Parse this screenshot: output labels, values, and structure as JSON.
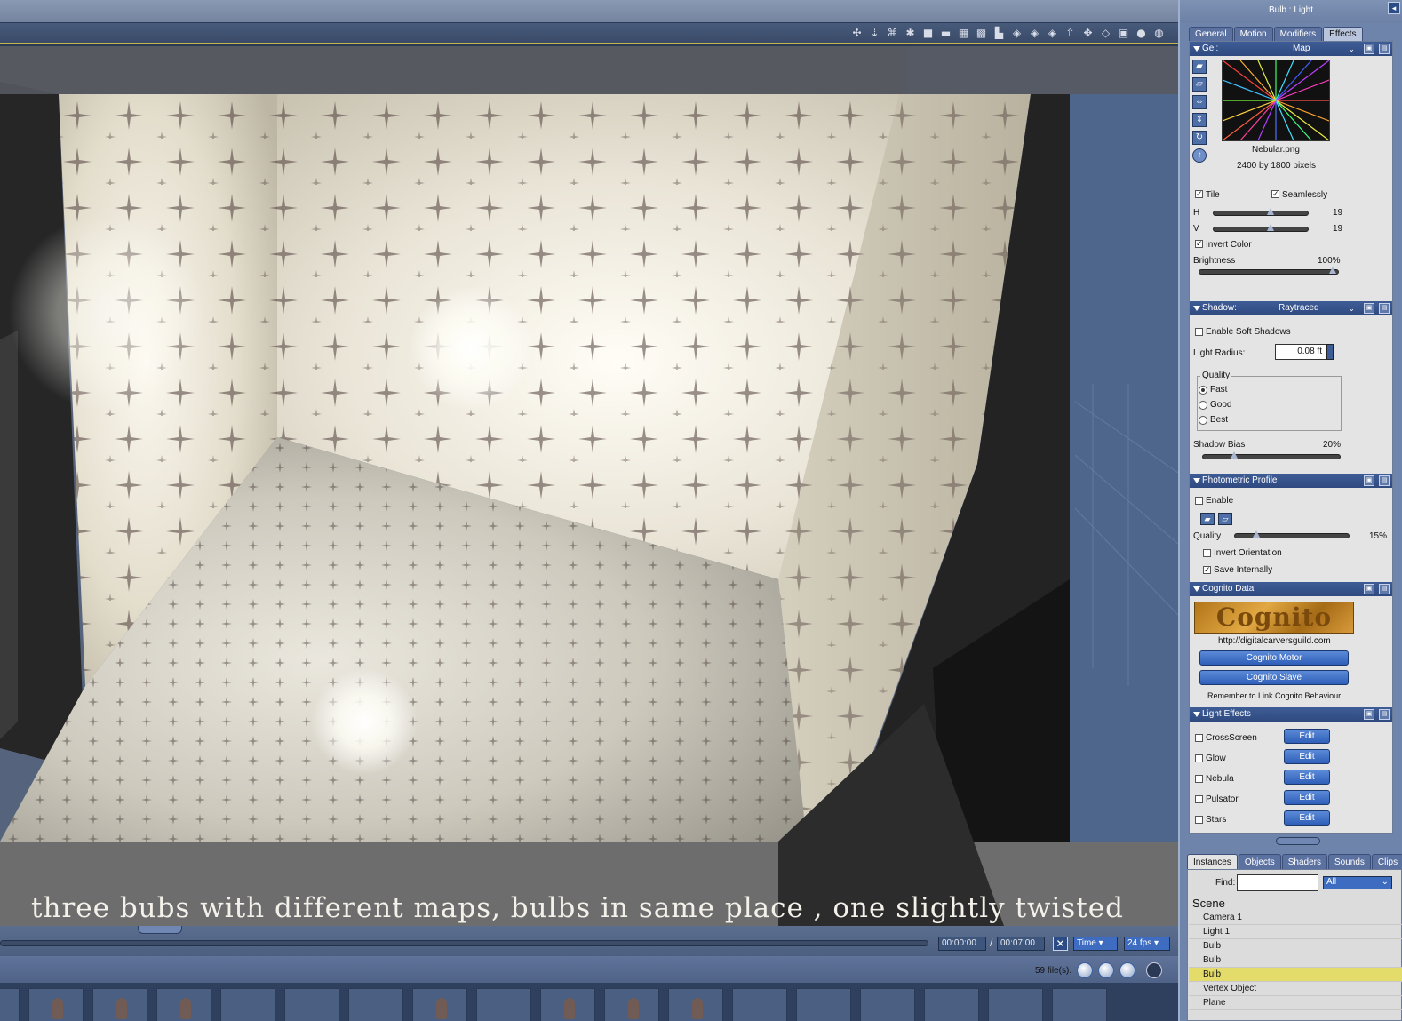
{
  "viewport": {
    "caption": "three bubs with different maps, bulbs in same place , one slightly twisted",
    "toolbar_icons": [
      "pivot-icon",
      "move-icon",
      "camera-icon",
      "target-icon",
      "single-view-icon",
      "dual-view-icon",
      "quad-view-icon",
      "grid-view-icon",
      "multi-view-icon",
      "shield-1-icon",
      "shield-2-icon",
      "shield-3-icon",
      "up-arrow-icon",
      "transform-icon",
      "box-icon",
      "cube-icon",
      "sphere-shaded-icon",
      "sphere-solid-icon"
    ]
  },
  "timeline": {
    "current_time": "00:00:00",
    "separator": "/",
    "end_time": "00:07:00",
    "mode": "Time",
    "fps": "24 fps"
  },
  "library": {
    "file_count": "59 file(s)."
  },
  "panel": {
    "title": "Bulb : Light",
    "close_glyph": "◂",
    "tabs": [
      "General",
      "Motion",
      "Modifiers",
      "Effects"
    ],
    "gel": {
      "header": "Gel:",
      "mode": "Map",
      "file_name": "Nebular.png",
      "file_size": "2400 by 1800 pixels",
      "tile_label": "Tile",
      "tile_checked": true,
      "seamless_label": "Seamlessly",
      "seamless_checked": true,
      "h_label": "H",
      "h_value": "19",
      "v_label": "V",
      "v_value": "19",
      "invert_label": "Invert Color",
      "invert_checked": true,
      "brightness_label": "Brightness",
      "brightness_value": "100%"
    },
    "shadow": {
      "header": "Shadow:",
      "mode": "Raytraced",
      "soft_label": "Enable Soft Shadows",
      "radius_label": "Light Radius:",
      "radius_value": "0.08 ft",
      "quality_label": "Quality",
      "quality_options": [
        "Fast",
        "Good",
        "Best"
      ],
      "quality_selected": "Fast",
      "bias_label": "Shadow Bias",
      "bias_value": "20%"
    },
    "photometric": {
      "header": "Photometric Profile",
      "enable_label": "Enable",
      "quality_label": "Quality",
      "quality_value": "15%",
      "invert_label": "Invert Orientation",
      "save_label": "Save Internally",
      "save_checked": true
    },
    "cognito": {
      "header": "Cognito Data",
      "logo_text": "Cognito",
      "url": "http://digitalcarversguild.com",
      "motor_button": "Cognito Motor",
      "slave_button": "Cognito Slave",
      "note": "Remember to Link Cognito Behaviour"
    },
    "light_effects": {
      "header": "Light Effects",
      "items": [
        {
          "label": "CrossScreen",
          "button": "Edit"
        },
        {
          "label": "Glow",
          "button": "Edit"
        },
        {
          "label": "Nebula",
          "button": "Edit"
        },
        {
          "label": "Pulsator",
          "button": "Edit"
        },
        {
          "label": "Stars",
          "button": "Edit"
        }
      ]
    }
  },
  "browser": {
    "tabs": [
      "Instances",
      "Objects",
      "Shaders",
      "Sounds",
      "Clips"
    ],
    "find_label": "Find:",
    "find_value": "",
    "filter": "All",
    "scene_label": "Scene",
    "items": [
      "Camera 1",
      "Light 1",
      "Bulb",
      "Bulb",
      "Bulb",
      "Vertex Object",
      "Plane"
    ],
    "selected_index": 4
  }
}
